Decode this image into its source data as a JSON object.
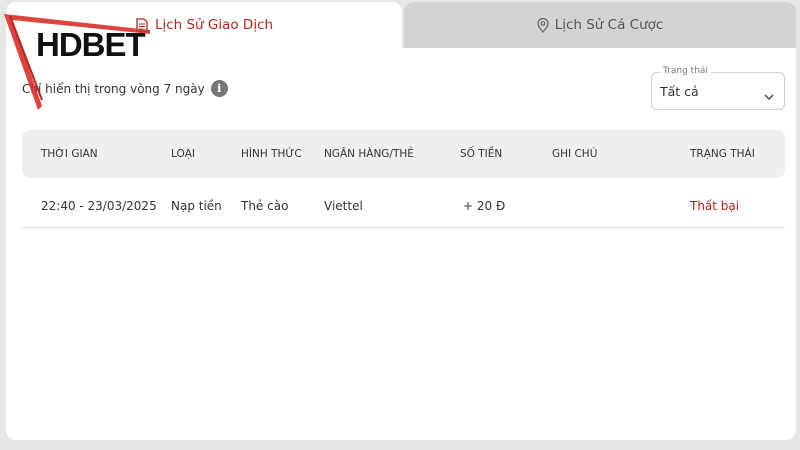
{
  "tabs": [
    {
      "label": "Lịch Sử Giao Dịch",
      "active": true,
      "icon": "receipt-icon"
    },
    {
      "label": "Lịch Sử Cá Cược",
      "active": false,
      "icon": "location-pin-icon"
    }
  ],
  "notice": {
    "text": "Chỉ hiển thị trong vòng 7 ngày",
    "icon": "info-icon"
  },
  "status_filter": {
    "legend": "Trạng thái",
    "value": "Tất cả"
  },
  "table": {
    "headers": [
      "THỜI GIAN",
      "LOẠI",
      "HÌNH THỨC",
      "NGÂN HÀNG/THẺ",
      "SỐ TIỀN",
      "GHI CHÚ",
      "TRẠNG THÁI"
    ],
    "rows": [
      {
        "time": "22:40 - 23/03/2025",
        "type": "Nạp tiền",
        "method": "Thẻ cào",
        "bank": "Viettel",
        "amount": "+ 20 Đ",
        "note": "",
        "status": "Thất bại"
      }
    ]
  },
  "logo": {
    "part1": "HD",
    "part2": "BET"
  },
  "colors": {
    "accent": "#b3261e",
    "tab_inactive": "#d3d3d3",
    "header_bg": "#efefef"
  }
}
